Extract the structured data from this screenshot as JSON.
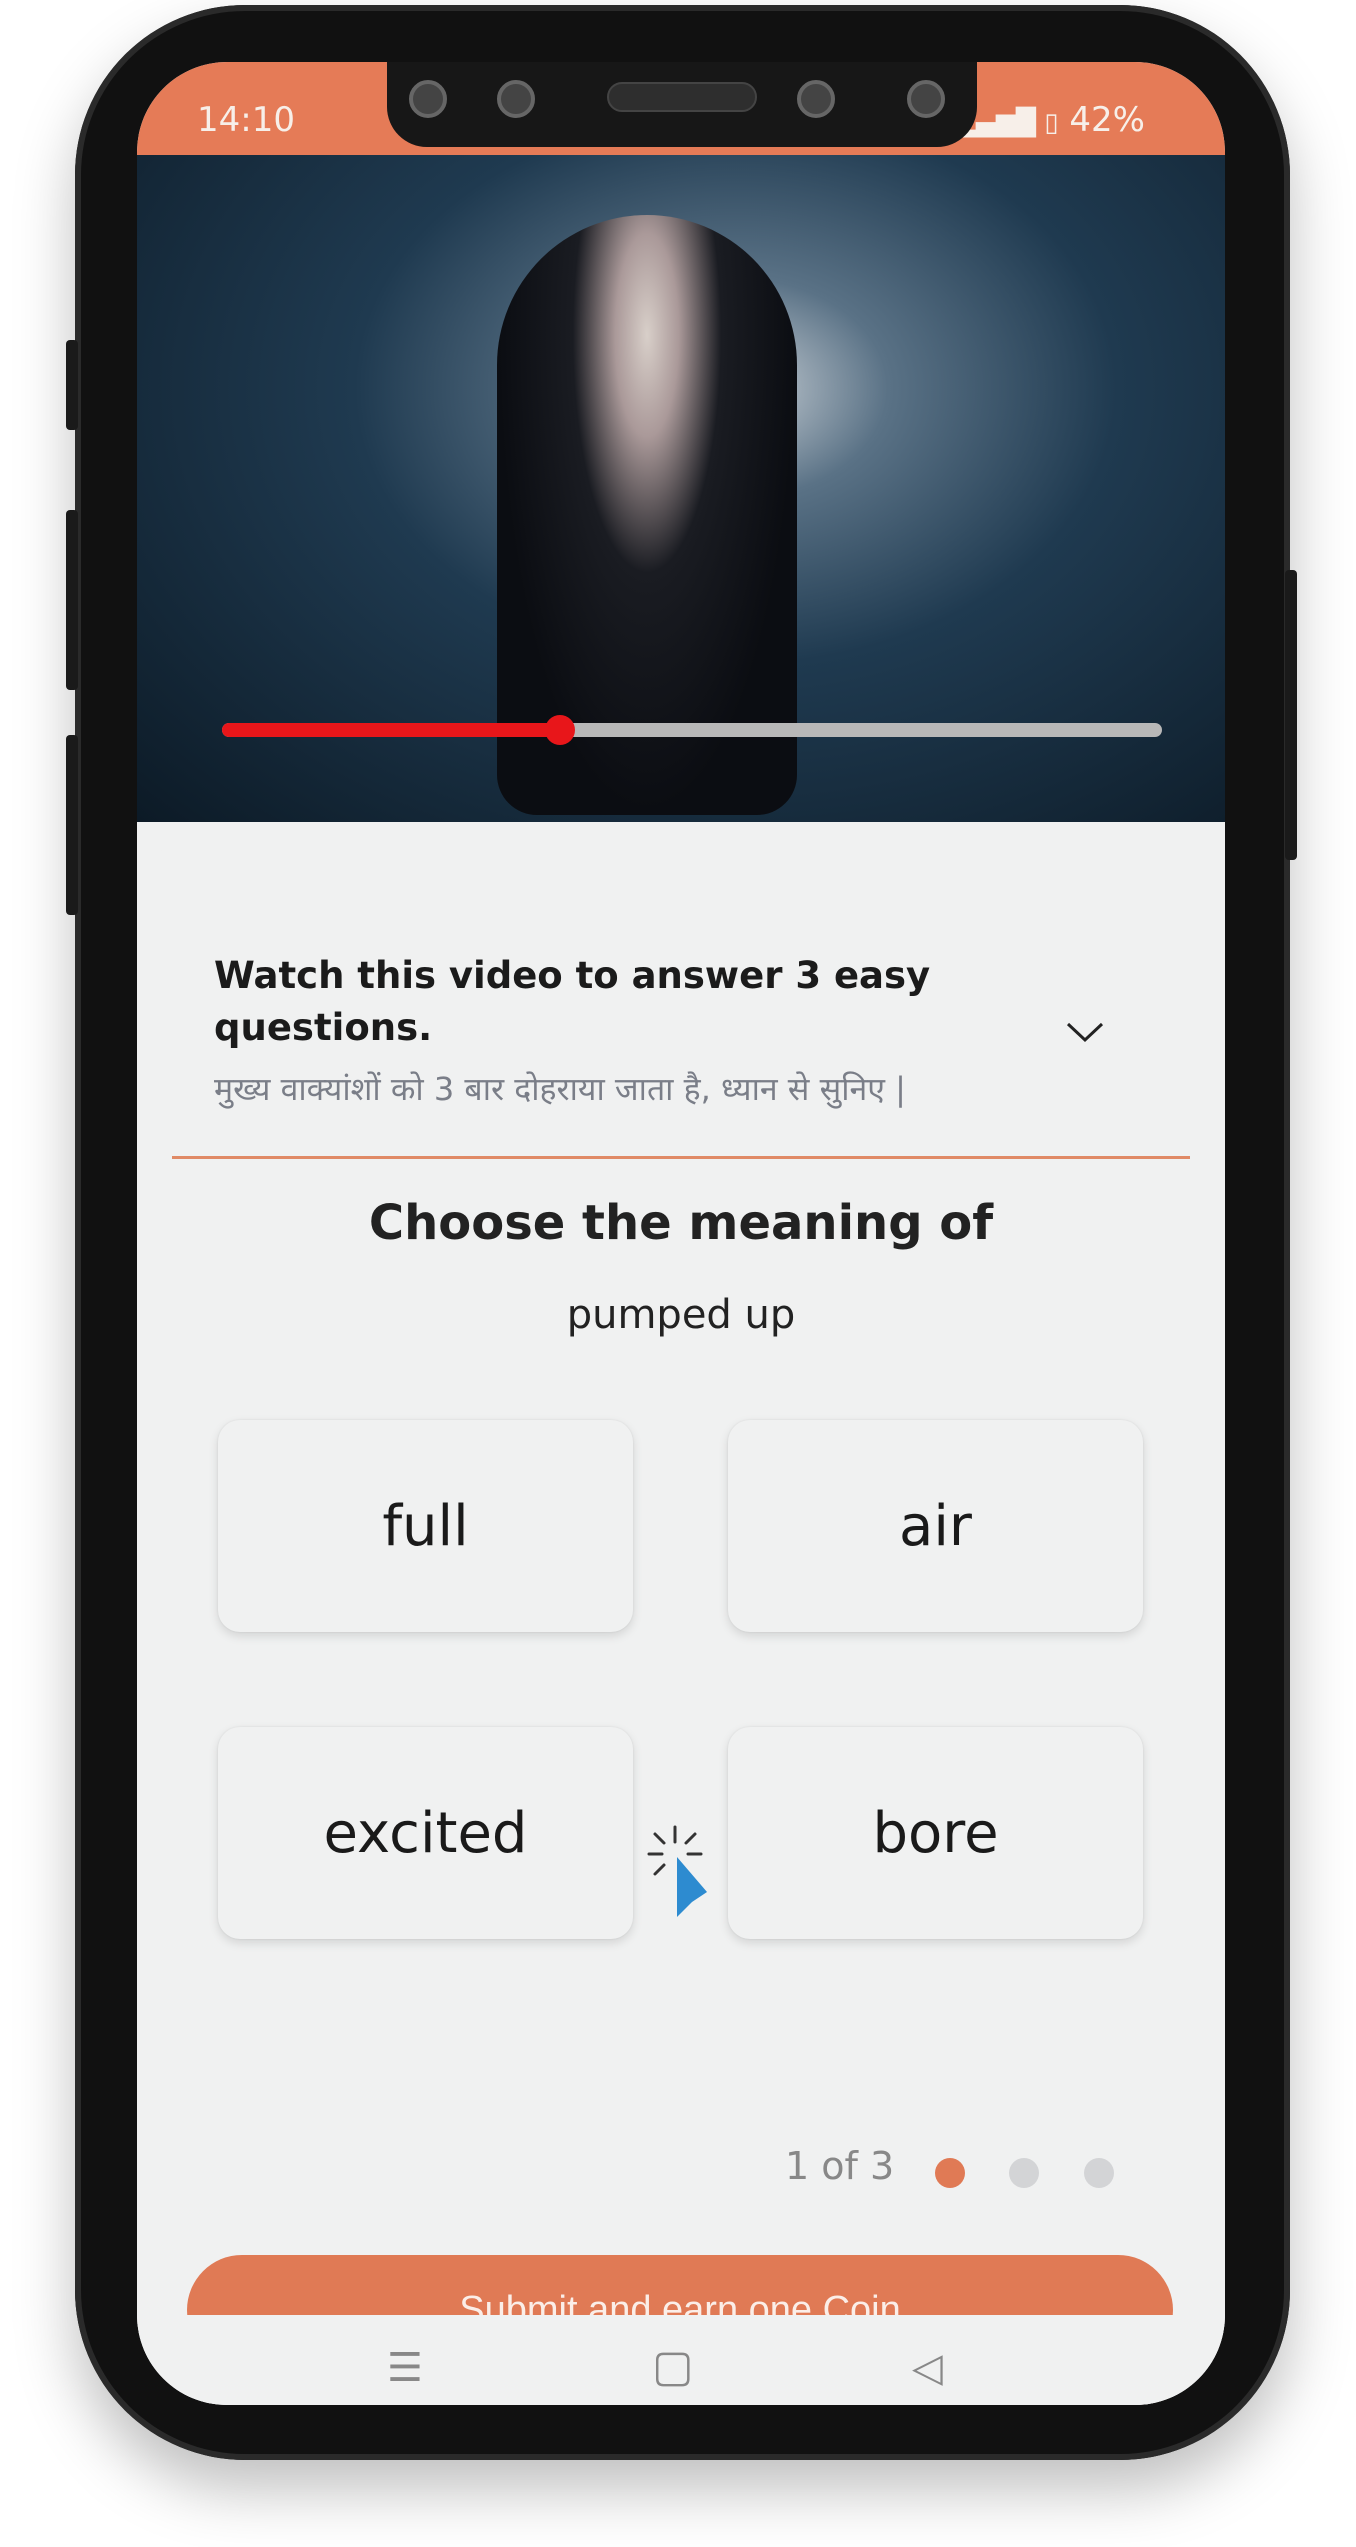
{
  "status_bar": {
    "time": "14:10",
    "battery": "42%"
  },
  "video": {
    "progress_percent": 36,
    "progress_color": "#e8161a"
  },
  "instructions": {
    "title": "Watch this video to answer 3 easy questions.",
    "subtitle": "मुख्य वाक्यांशों  को 3  बार दोहराया जाता है, ध्यान से सुनिए |",
    "toggle_icon": "chevron-down-icon"
  },
  "question": {
    "prompt": "Choose the meaning of",
    "phrase": "pumped up"
  },
  "options": [
    {
      "label": "full"
    },
    {
      "label": "air"
    },
    {
      "label": "excited"
    },
    {
      "label": "bore"
    }
  ],
  "pager": {
    "text": "1 of 3",
    "current": 1,
    "total": 3
  },
  "submit": {
    "label": "Submit and earn one Coin"
  },
  "colors": {
    "accent": "#e57b57",
    "button": "#e07a55",
    "dot_active": "#e07a55",
    "dot_inactive": "#d3d4d6"
  },
  "nav_icons": [
    "menu-icon",
    "home-icon",
    "back-icon"
  ]
}
